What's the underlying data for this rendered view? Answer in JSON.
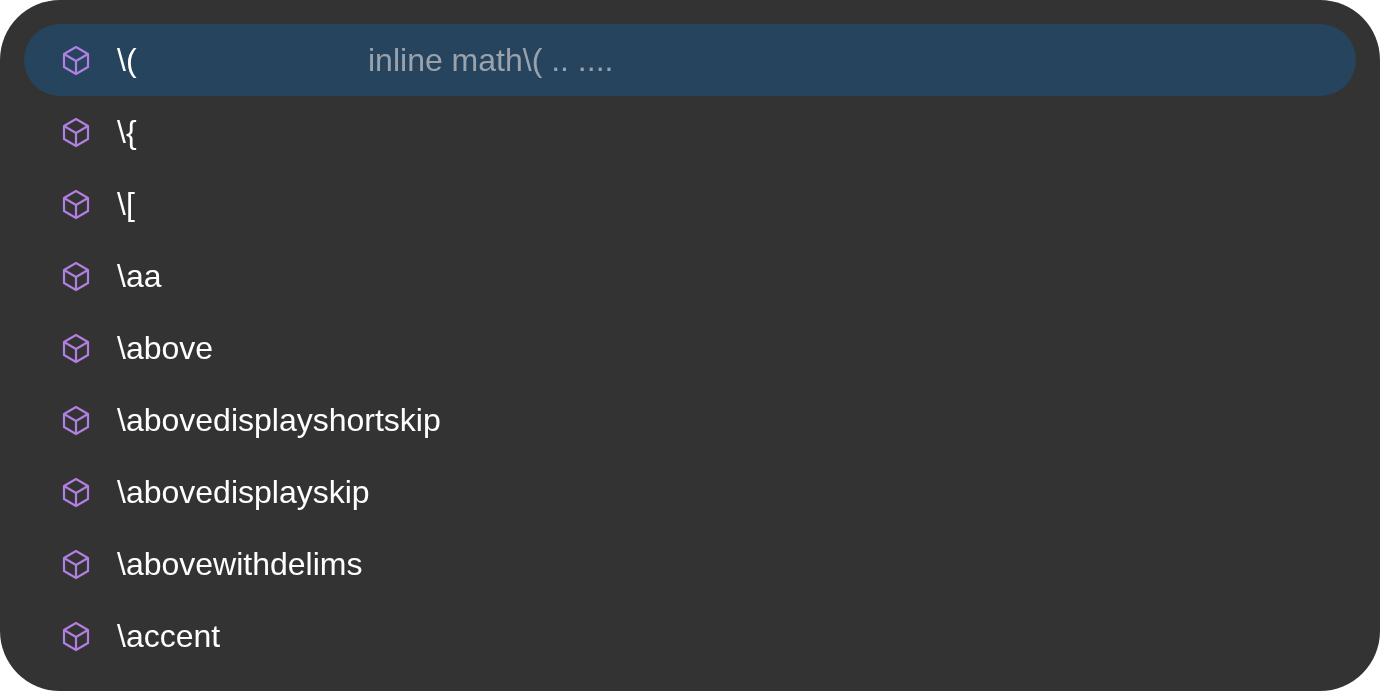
{
  "suggestions": [
    {
      "label": "\\(",
      "detail": "inline math\\( .. ....",
      "selected": true
    },
    {
      "label": "\\{",
      "selected": false
    },
    {
      "label": "\\[",
      "selected": false
    },
    {
      "label": "\\aa",
      "selected": false
    },
    {
      "label": "\\above",
      "selected": false
    },
    {
      "label": "\\abovedisplayshortskip",
      "selected": false
    },
    {
      "label": "\\abovedisplayskip",
      "selected": false
    },
    {
      "label": "\\abovewithdelims",
      "selected": false
    },
    {
      "label": "\\accent",
      "selected": false
    }
  ]
}
